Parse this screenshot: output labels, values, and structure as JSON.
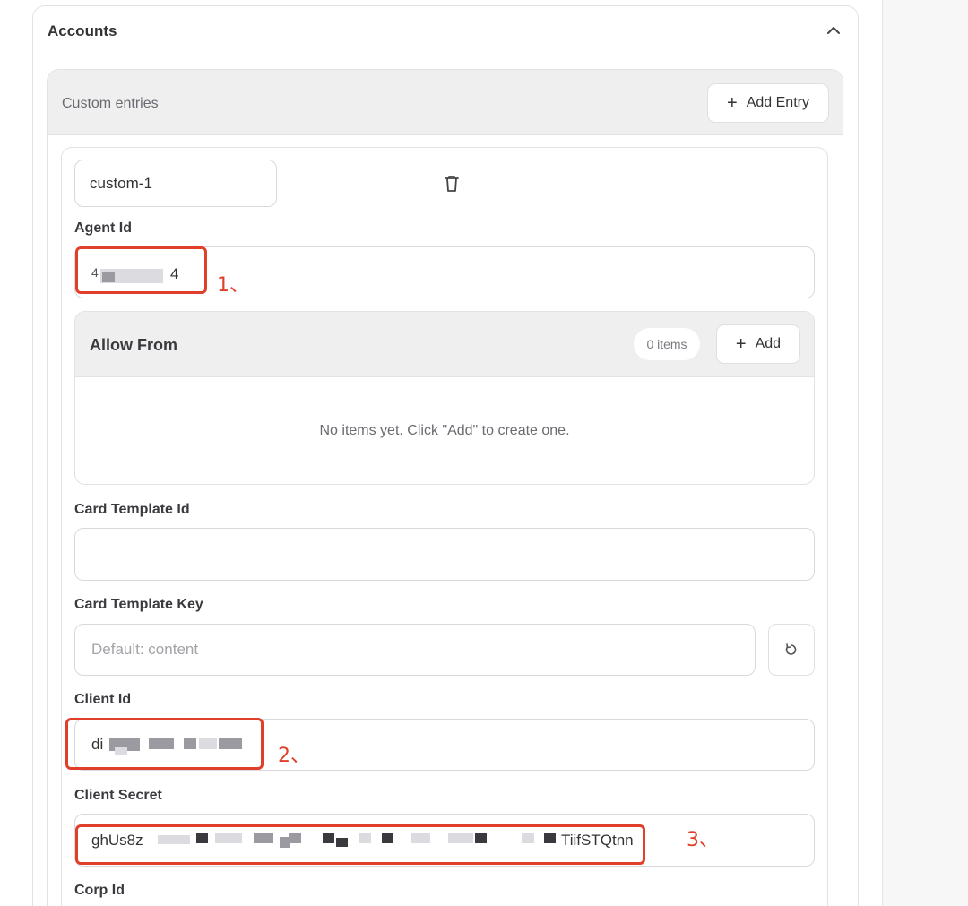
{
  "accounts": {
    "title": "Accounts"
  },
  "entries": {
    "title": "Custom entries",
    "add_entry_label": "Add Entry"
  },
  "entry": {
    "name_value": "custom-1",
    "agent_id": {
      "label": "Agent Id",
      "value_start": "4",
      "value_end": "4"
    },
    "allow_from": {
      "title": "Allow From",
      "count": "0 items",
      "add_label": "Add",
      "empty_text": "No items yet. Click \"Add\" to create one."
    },
    "card_template_id": {
      "label": "Card Template Id",
      "value": ""
    },
    "card_template_key": {
      "label": "Card Template Key",
      "placeholder": "Default: content"
    },
    "client_id": {
      "label": "Client Id",
      "value_start": "di"
    },
    "client_secret": {
      "label": "Client Secret",
      "value_start": "ghUs8z",
      "value_end": "TiifSTQtnn"
    },
    "corp_id": {
      "label": "Corp Id"
    }
  },
  "annotations": [
    "1、",
    "2、",
    "3、"
  ],
  "colors": {
    "annotation": "#e0402a",
    "header_bg": "#efeff0"
  }
}
